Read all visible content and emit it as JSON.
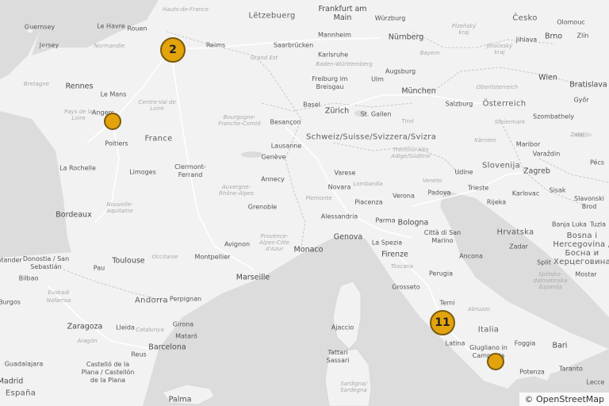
{
  "map": {
    "attribution": "© OpenStreetMap",
    "colors": {
      "land": "#f2f2f2",
      "sea": "#dcdcdc",
      "marker_fill": "#e3a30c",
      "marker_border": "#7a5a10"
    },
    "markers": [
      {
        "name": "cluster-paris",
        "count": "2"
      },
      {
        "name": "marker-angers",
        "count": ""
      },
      {
        "name": "cluster-rome",
        "count": "11"
      },
      {
        "name": "marker-salerno",
        "count": ""
      }
    ],
    "labels": {
      "guernsey": "Guernsey",
      "jersey": "Jersey",
      "le_havre": "Le Havre",
      "rouen": "Rouen",
      "hauts_de_france": "Hauts-de-France",
      "normandie": "Normandie",
      "reims": "Reims",
      "letzeburg": "Lëtzebuerg",
      "frankfurt": "Frankfurt am Main",
      "wurzburg": "Würzburg",
      "cesko": "Česko",
      "olomouc": "Olomouc",
      "zlin": "Zlín",
      "jihlava": "Jihlava",
      "brno": "Brno",
      "plzensky": "Plzeňský kraj",
      "jihocesky": "Jihočeský kraj",
      "mannheim": "Mannheim",
      "nurnberg": "Nürnberg",
      "saarbrucken": "Saarbrücken",
      "karlsruhe": "Karlsruhe",
      "grand_est": "Grand Est",
      "bayern": "Bayern",
      "baden_wurttemberg": "Baden-Württemberg",
      "augsburg": "Augsburg",
      "wien": "Wien",
      "bratislava": "Bratislava",
      "gyor": "Győr",
      "bretagne": "Bretagne",
      "rennes": "Rennes",
      "le_mans": "Le Mans",
      "freiburg": "Freiburg im Breisgau",
      "ulm": "Ulm",
      "munchen": "München",
      "oberosterreich": "Oberösterreich",
      "pays_de_la_loire": "Pays de la Loire",
      "angers": "Angers",
      "centre_val_de_loire": "Centre-Val de Loire",
      "basel": "Basel",
      "zurich": "Zürich",
      "st_gallen": "St. Gallen",
      "salzburg": "Salzburg",
      "osterreich": "Österreich",
      "szombathely": "Szombathely",
      "bourgogne": "Bourgogne-Franche-Comté",
      "besancon": "Besançon",
      "schweiz": "Schweiz/Suisse/Svizzera/Svizra",
      "tirol": "Tirol",
      "steiermark": "Steiermark",
      "poitiers": "Poitiers",
      "france": "France",
      "lausanne": "Lausanne",
      "trentino": "Trentino-Alto Adige/Südtirol",
      "karnten": "Kärnten",
      "maribor": "Maribor",
      "varazdin": "Varaždin",
      "zalai": "Zalai",
      "la_rochelle": "La Rochelle",
      "limoges": "Limoges",
      "clermont": "Clermont-Ferrand",
      "geneve": "Genève",
      "udine": "Udine",
      "slovenija": "Slovenija",
      "zagreb": "Zagreb",
      "pecs": "Pécs",
      "annecy": "Annecy",
      "varese": "Varese",
      "veneto": "Veneto",
      "trieste": "Trieste",
      "karlovac": "Karlovac",
      "sisak": "Sisak",
      "novara": "Novara",
      "lombardia": "Lombardia",
      "padova": "Padova",
      "rijeka": "Rijeka",
      "slavonski_brod": "Slavonski Brod",
      "auvergne": "Auvergne-Rhône-Alpes",
      "verona": "Verona",
      "bordeaux": "Bordeaux",
      "nouvelle_aquitaine": "Nouvelle-Aquitaine",
      "grenoble": "Grenoble",
      "piemonte": "Piemonte",
      "piacenza": "Piacenza",
      "banja_luka": "Banja Luka",
      "alessandria": "Alessandria",
      "parma": "Parma",
      "bologna": "Bologna",
      "avignon": "Avignon",
      "hrvatska": "Hrvatska",
      "tuzla": "Tuzla",
      "provence": "Provence-Alpes-Côte d'Azur",
      "genova": "Genova",
      "citta_san_marino": "Città di San Marino",
      "bosna": "Bosna i Hercegovina / Босна и Херцеговина",
      "zadar": "Zadar",
      "la_spezia": "La Spezia",
      "toulouse": "Toulouse",
      "montpellier": "Montpellier",
      "monaco": "Monaco",
      "occitanie": "Occitanie",
      "firenze": "Firenze",
      "toscana": "Toscana",
      "ancona": "Ancona",
      "andorre": "ntander",
      "donostia": "Donostia / San Sebastián",
      "pau": "Pau",
      "marseille": "Marseille",
      "perugia": "Perugia",
      "split": "Split",
      "mostar": "Mostar",
      "bilbao": "Bilbao",
      "euskadi": "Euskadi",
      "nafarroa": "Nafarroa",
      "andorra": "Andorra",
      "perpignan": "Perpignan",
      "grosseto": "Grosseto",
      "splitsko": "Splitsko-dalmatinska županija",
      "burgos": "Burgos",
      "terni": "Terni",
      "abruzzo": "Abruzzo",
      "zaragoza": "Zaragoza",
      "lleida": "Lleida",
      "girona": "Girona",
      "catalunya": "Catalunya",
      "ajaccio": "Ajaccio",
      "italia": "Italia",
      "bari": "Bari",
      "aragon": "Aragón",
      "mataro": "Mataró",
      "barcelona": "Barcelona",
      "latina": "Latina",
      "foggia": "Foggia",
      "reus": "Reus",
      "tattari": "Tattari Sassari",
      "giugliano": "Giugliano in Campania",
      "guadalajara": "Guadalajara",
      "castello": "Castelló de la Plana / Castellón de la Plana",
      "taranto": "Taranto",
      "potenza": "Potenza",
      "lecce": "Lecce",
      "madrid": "Madrid",
      "sardigna": "Sardigna/ Sardegna",
      "palma": "Palma",
      "espana": "España"
    }
  }
}
